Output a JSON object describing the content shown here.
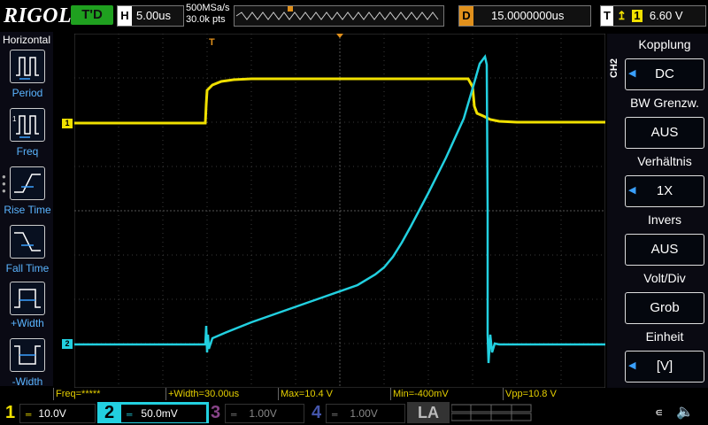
{
  "brand": "RIGOL",
  "top": {
    "trig_status": "T'D",
    "horizontal": {
      "label": "H",
      "value": "5.00us"
    },
    "sample_rate": "500MSa/s",
    "memory_depth": "30.0k pts",
    "delay": {
      "label": "D",
      "value": "15.0000000us"
    },
    "trigger": {
      "label": "T",
      "channel": "1",
      "level": "6.60 V"
    }
  },
  "left_panel": {
    "title": "Horizontal",
    "items": [
      {
        "label": "Period",
        "icon": "period-icon"
      },
      {
        "label": "Freq",
        "icon": "freq-icon"
      },
      {
        "label": "Rise Time",
        "icon": "rise-time-icon"
      },
      {
        "label": "Fall Time",
        "icon": "fall-time-icon"
      },
      {
        "label": "+Width",
        "icon": "pos-width-icon"
      },
      {
        "label": "-Width",
        "icon": "neg-width-icon"
      }
    ]
  },
  "right_panel": {
    "channel_tag": "CH2",
    "items": [
      {
        "title": "Kopplung",
        "value": "DC"
      },
      {
        "title": "BW Grenzw.",
        "value": "AUS"
      },
      {
        "title": "Verhältnis",
        "value": "1X"
      },
      {
        "title": "Invers",
        "value": "AUS"
      },
      {
        "title": "Volt/Div",
        "value": "Grob"
      },
      {
        "title": "Einheit",
        "value": "[V]"
      }
    ]
  },
  "measurements": [
    "Freq=*****",
    "+Width=30.00us",
    "Max=10.4 V",
    "Min=-400mV",
    "Vpp=10.8 V"
  ],
  "channels": [
    {
      "num": "1",
      "scale": "10.0V",
      "color": "#f0e000"
    },
    {
      "num": "2",
      "scale": "50.0mV",
      "color": "#22d0e0"
    },
    {
      "num": "3",
      "scale": "1.00V",
      "color": "#cc44cc"
    },
    {
      "num": "4",
      "scale": "1.00V",
      "color": "#3366ff"
    }
  ],
  "la": "LA",
  "waveform": {
    "ch1_marker": "1",
    "ch2_marker": "2",
    "trigger_marker": "T"
  },
  "colors": {
    "ch1": "#f0e000",
    "ch2": "#22d0e0",
    "delay": "#e0901c",
    "menu_label": "#5ab4ff"
  }
}
